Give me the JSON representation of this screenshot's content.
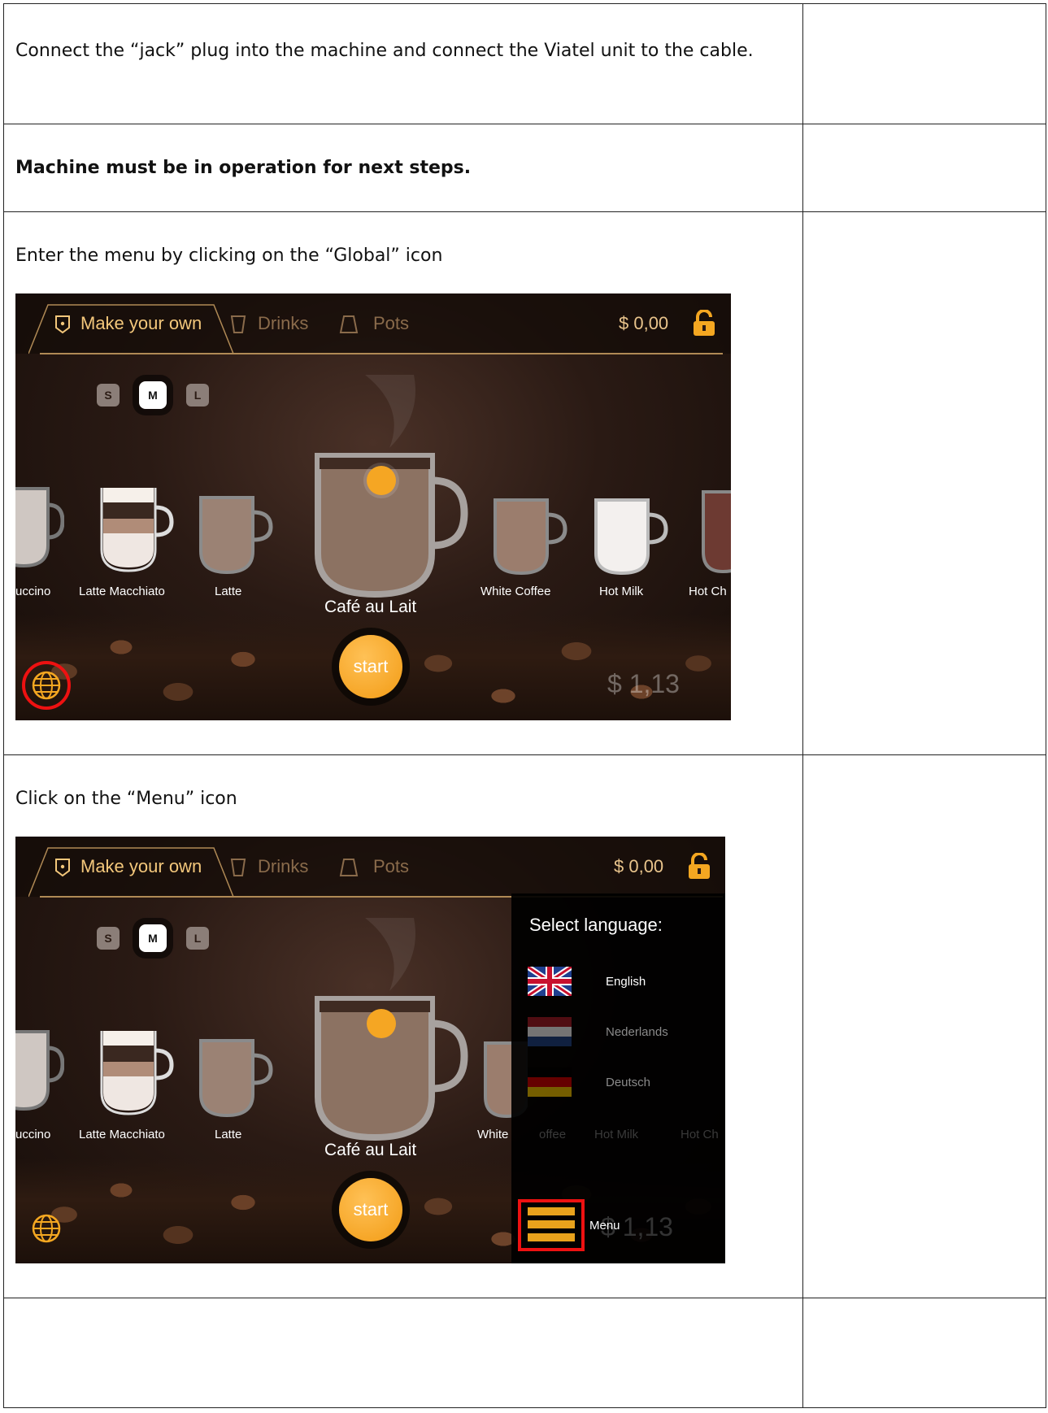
{
  "steps": [
    {
      "text": "Connect the “jack” plug into the machine and connect the Viatel unit to the cable.",
      "bold": false
    },
    {
      "text": "Machine must be in operation for next steps.",
      "bold": true
    },
    {
      "text": "Enter the menu by clicking on the “Global” icon"
    },
    {
      "text": "Click on the “Menu” icon"
    }
  ],
  "machine_ui": {
    "tabs": [
      "Make your own",
      "Drinks",
      "Pots"
    ],
    "balance": "$ 0,00",
    "sizes": [
      "S",
      "M",
      "L"
    ],
    "drinks": [
      "uccino",
      "Latte Macchiato",
      "Latte",
      "Café au Lait",
      "White Coffee",
      "Hot Milk",
      "Hot Ch"
    ],
    "start_label": "start",
    "price": "$ 1,13",
    "language_panel": {
      "title": "Select language:",
      "languages": [
        "English",
        "Nederlands",
        "Deutsch"
      ],
      "menu_label": "Menu",
      "partial_labels": {
        "white": "White",
        "offee": "offee",
        "hot_milk": "Hot Milk",
        "hot_ch": "Hot Ch",
        "price_frag": "$ 1,13"
      }
    }
  },
  "colors": {
    "accent": "#f29b14",
    "highlight": "#e11111",
    "tab_active": "#f3c77b"
  }
}
